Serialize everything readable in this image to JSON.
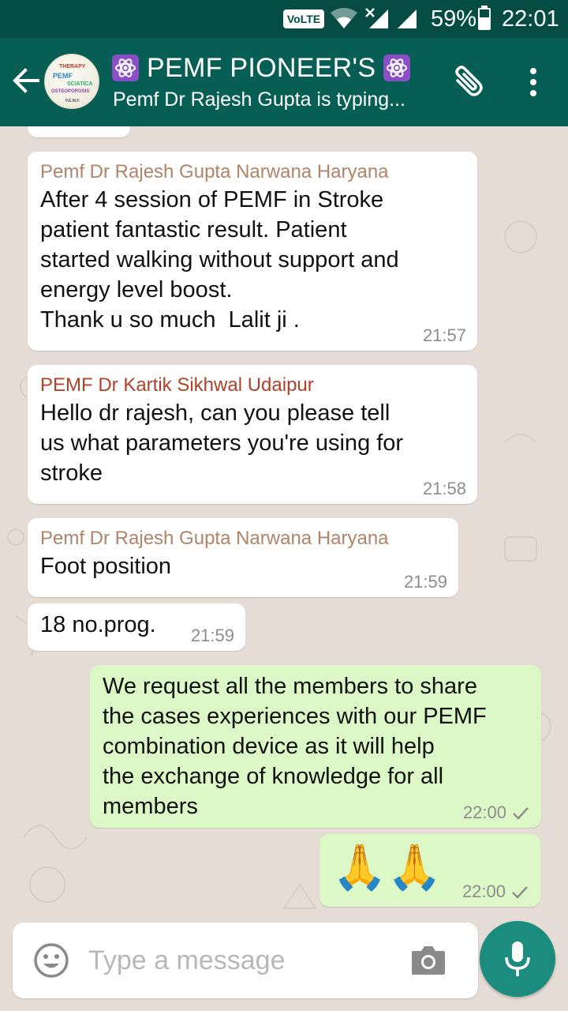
{
  "status_bar": {
    "volte": "VoLTE",
    "battery": "59%",
    "battery_level": 0.59,
    "time": "22:01"
  },
  "header": {
    "title": "PEMF PIONEER'S",
    "title_emoji_icon": "atom-symbol-icon",
    "subtitle": "Pemf Dr Rajesh Gupta is typing...",
    "avatar_words": [
      "THERAPY",
      "PEMF",
      "SCIATICA",
      "OSTEOPOROSIS",
      "P.E.M.F."
    ]
  },
  "messages": [
    {
      "type": "in",
      "sender": "Pemf Dr Rajesh Gupta Narwana Haryana",
      "text": "After 4 session of PEMF in Stroke\npatient fantastic result. Patient\nstarted walking without support and\nenergy level boost.\nThank u so much  Lalit ji .",
      "time": "21:57"
    },
    {
      "type": "in",
      "sender": "PEMF Dr Kartik Sikhwal Udaipur",
      "text": "Hello dr rajesh, can you please tell\nus what parameters you're using for\nstroke",
      "time": "21:58"
    },
    {
      "type": "in",
      "sender": "Pemf Dr Rajesh Gupta Narwana Haryana",
      "text": "Foot position",
      "time": "21:59"
    },
    {
      "type": "in",
      "sender": "",
      "text": "18 no.prog.",
      "time": "21:59"
    },
    {
      "type": "out",
      "text": "We request all the members to share\nthe cases experiences with our PEMF\ncombination device as it will help\nthe exchange of knowledge for all\nmembers",
      "time": "22:00"
    },
    {
      "type": "out",
      "text": "🙏🙏",
      "time": "22:00"
    }
  ],
  "composer": {
    "placeholder": "Type a message"
  },
  "colors": {
    "app_bar": "#075e54",
    "status_bar": "#054d44",
    "outgoing_bubble": "#dcf8c6",
    "mic_button": "#1c8c7e"
  }
}
